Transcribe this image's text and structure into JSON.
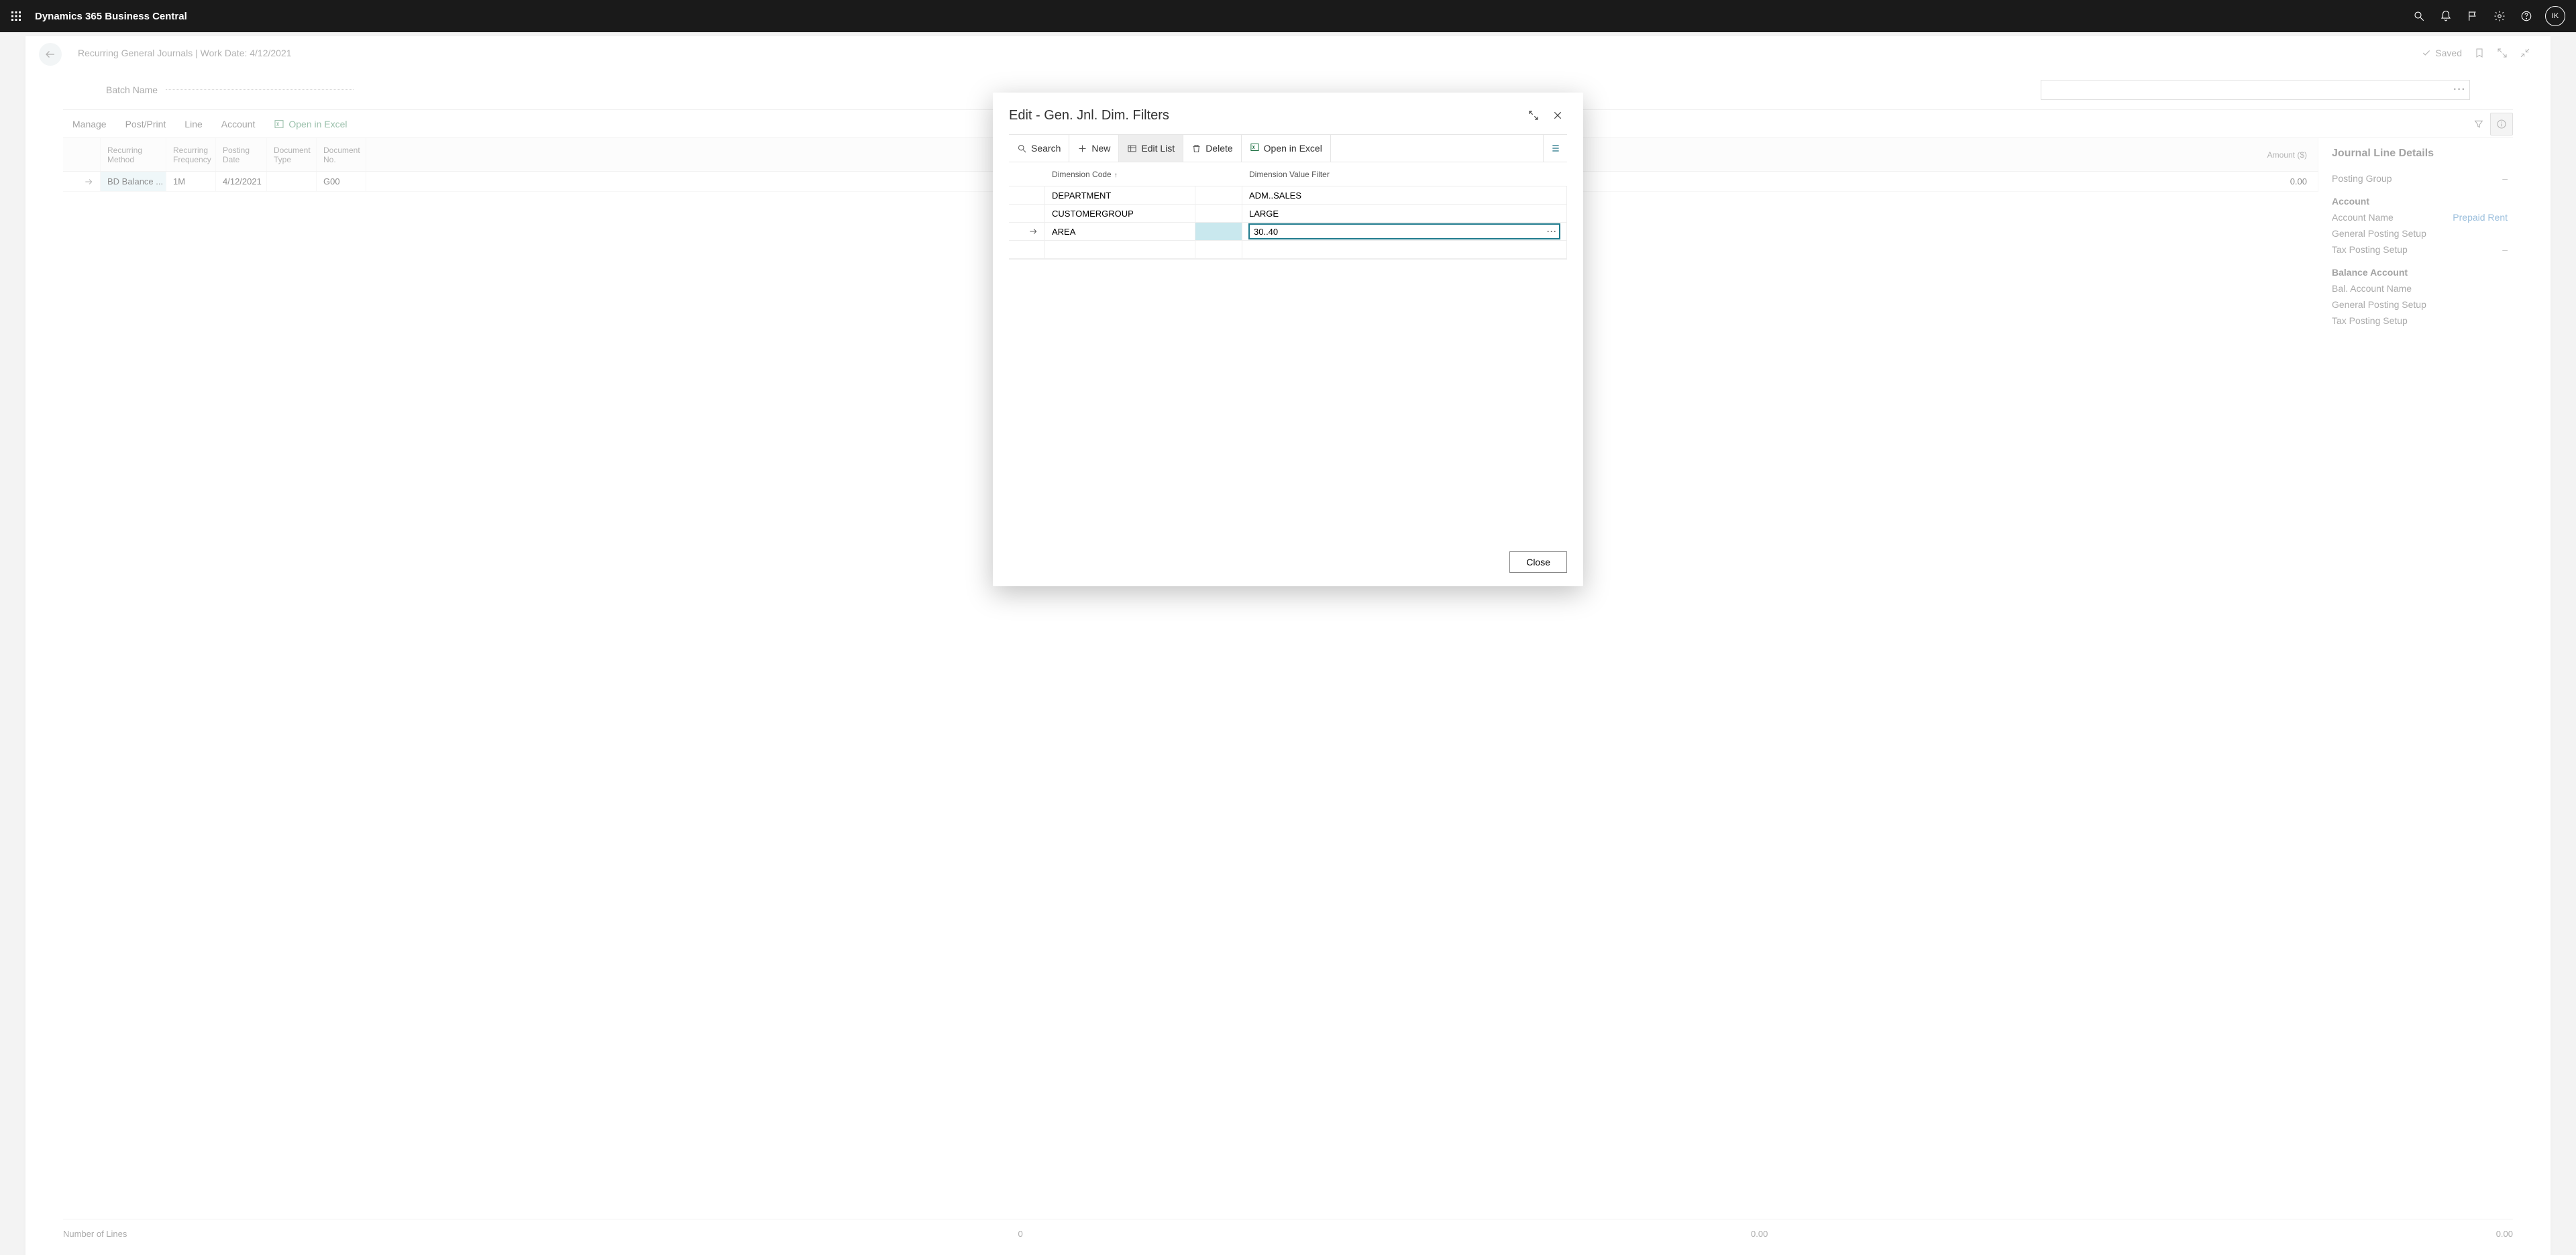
{
  "appbar": {
    "title": "Dynamics 365 Business Central",
    "avatar": "IK"
  },
  "page": {
    "title": "Recurring General Journals | Work Date: 4/12/2021",
    "saved_label": "Saved",
    "batch_label": "Batch Name"
  },
  "toolbar": {
    "manage": "Manage",
    "post_print": "Post/Print",
    "line": "Line",
    "account": "Account",
    "open_excel": "Open in Excel"
  },
  "grid": {
    "headers": {
      "recurring_method": "Recurring Method",
      "recurring_frequency": "Recurring Frequency",
      "posting_date": "Posting Date",
      "document_type": "Document Type",
      "document_no": "Document No.",
      "amount": "Amount ($)"
    },
    "row": {
      "recurring_method": "BD Balance ...",
      "recurring_frequency": "1M",
      "posting_date": "4/12/2021",
      "document_type": "",
      "document_no": "G00",
      "amount": "0.00"
    }
  },
  "details": {
    "title": "Journal Line Details",
    "posting_group": "Posting Group",
    "account_section": "Account",
    "account_name_label": "Account Name",
    "account_name_value": "Prepaid Rent",
    "general_posting_setup": "General Posting Setup",
    "tax_posting_setup": "Tax Posting Setup",
    "balance_section": "Balance Account",
    "bal_account_name": "Bal. Account Name",
    "dash": "–"
  },
  "footer": {
    "label": "Number of Lines",
    "v1": "0",
    "v2": "0.00",
    "v3": "0.00"
  },
  "dialog": {
    "title": "Edit - Gen. Jnl. Dim. Filters",
    "search": "Search",
    "new": "New",
    "edit_list": "Edit List",
    "delete": "Delete",
    "open_excel": "Open in Excel",
    "close": "Close",
    "headers": {
      "code": "Dimension Code",
      "filter": "Dimension Value Filter"
    },
    "rows": [
      {
        "code": "DEPARTMENT",
        "filter": "ADM..SALES",
        "selected": false
      },
      {
        "code": "CUSTOMERGROUP",
        "filter": "LARGE",
        "selected": false
      },
      {
        "code": "AREA",
        "filter": "30..40",
        "selected": true,
        "editing": true
      }
    ]
  }
}
